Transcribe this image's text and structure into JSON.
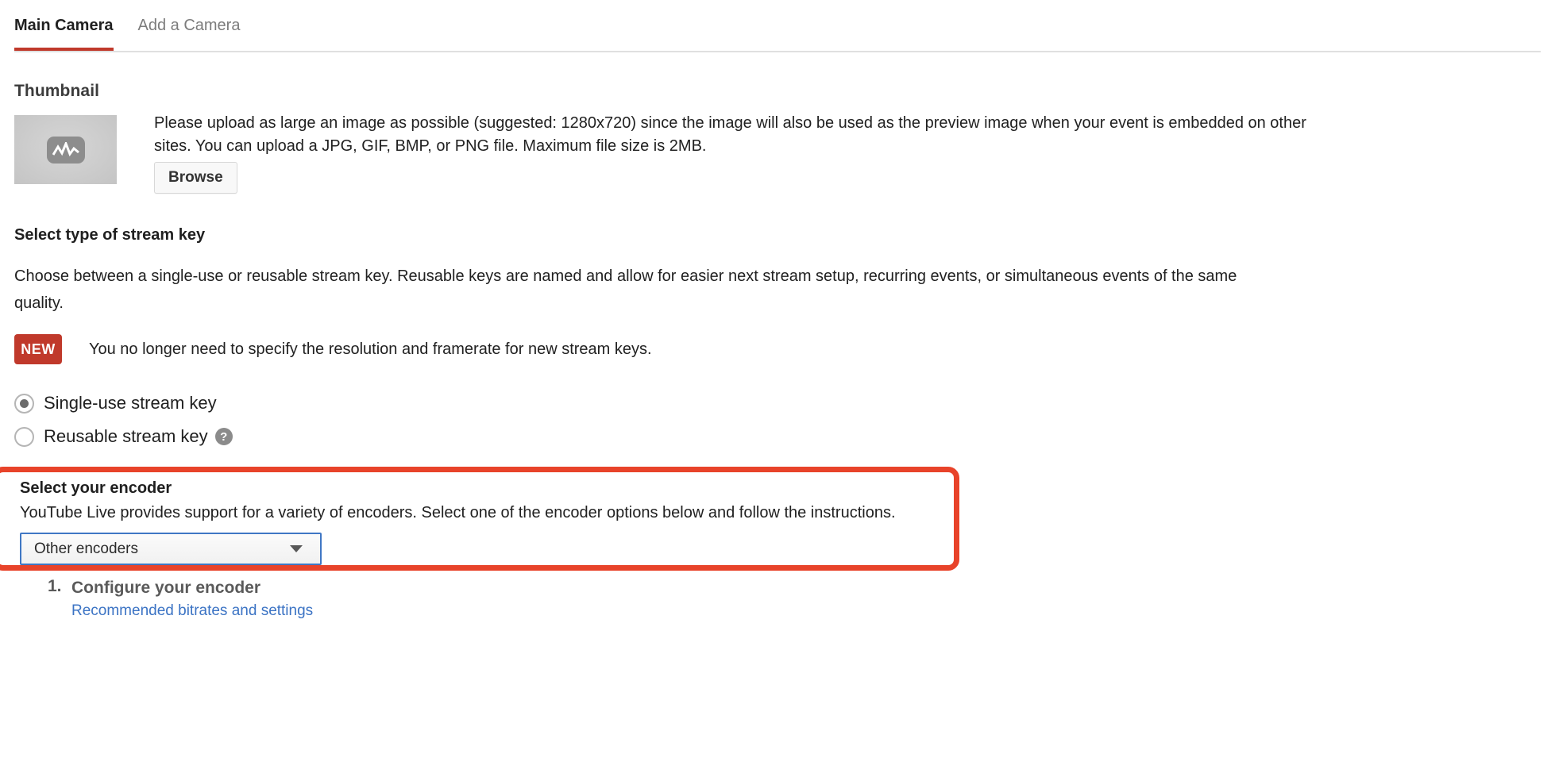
{
  "tabs": [
    {
      "label": "Main Camera",
      "active": true
    },
    {
      "label": "Add a Camera",
      "active": false
    }
  ],
  "thumbnail": {
    "heading": "Thumbnail",
    "placeholder_icon": "video-pulse-icon",
    "description": "Please upload as large an image as possible (suggested: 1280x720) since the image will also be used as the preview image when your event is embedded on other sites. You can upload a JPG, GIF, BMP, or PNG file. Maximum file size is 2MB.",
    "browse_label": "Browse"
  },
  "stream_key": {
    "heading": "Select type of stream key",
    "description": "Choose between a single-use or reusable stream key. Reusable keys are named and allow for easier next stream setup, recurring events, or simultaneous events of the same quality.",
    "new_badge": "NEW",
    "new_text": "You no longer need to specify the resolution and framerate for new stream keys.",
    "options": [
      {
        "label": "Single-use stream key",
        "checked": true,
        "help": false
      },
      {
        "label": "Reusable stream key",
        "checked": false,
        "help": true,
        "help_glyph": "?"
      }
    ]
  },
  "encoder": {
    "heading": "Select your encoder",
    "description": "YouTube Live provides support for a variety of encoders. Select one of the encoder options below and follow the instructions.",
    "select_value": "Other encoders",
    "select_arrow": "chevron-down-icon",
    "highlight_color": "#e8432a",
    "focus_color": "#3f77c4"
  },
  "steps": [
    {
      "number": "1.",
      "title": "Configure your encoder",
      "link": "Recommended bitrates and settings"
    }
  ],
  "colors": {
    "tab_active_underline": "#c0392b",
    "new_badge_bg": "#c0392b",
    "link": "#3b73c4"
  }
}
